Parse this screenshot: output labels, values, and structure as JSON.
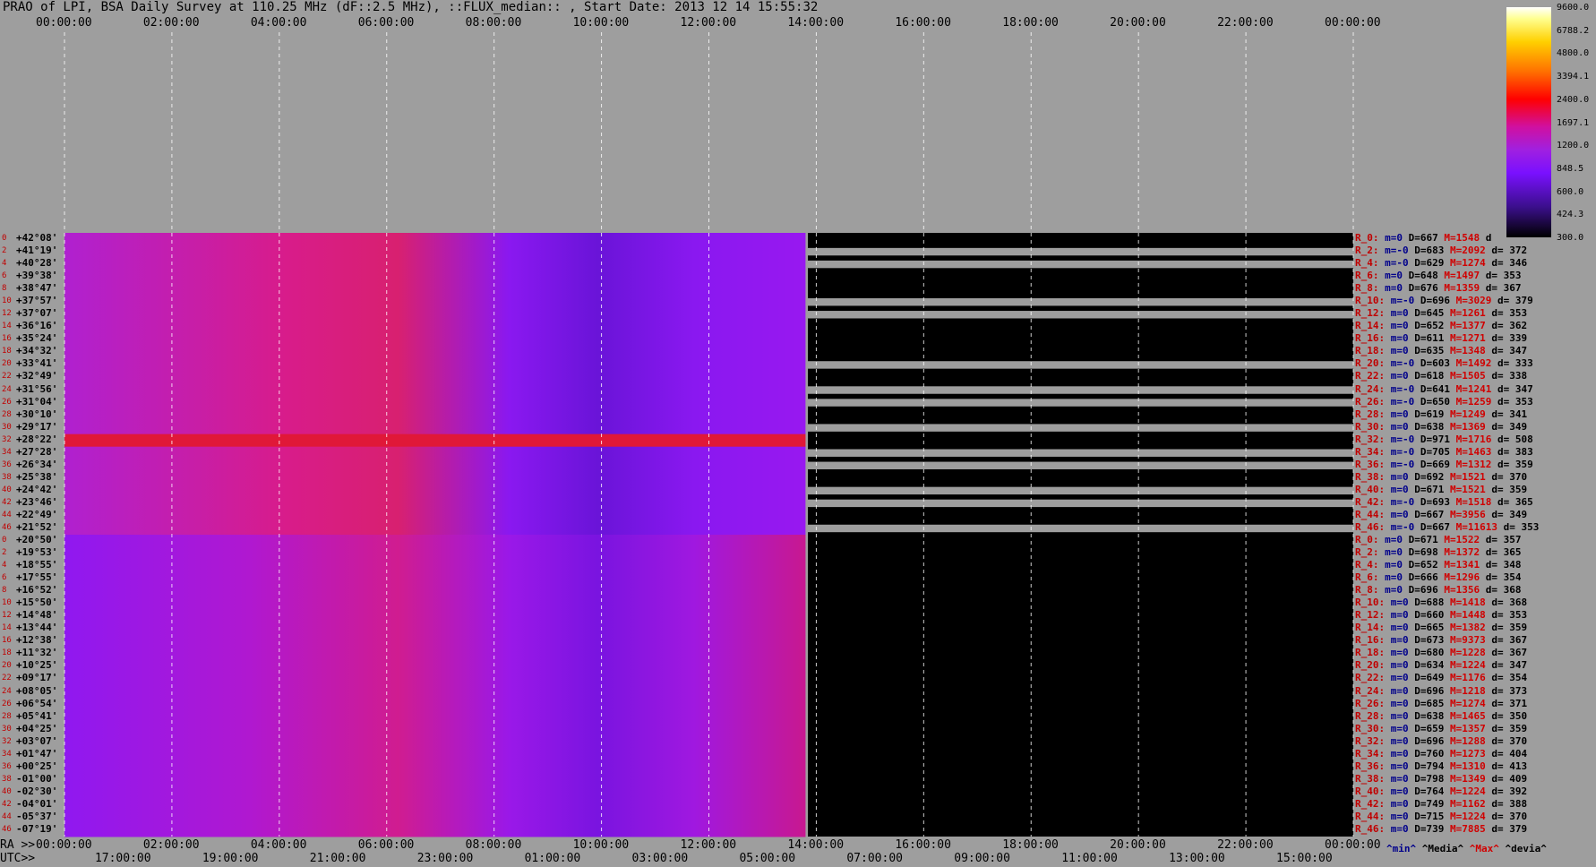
{
  "title": "PRAO of LPI, BSA Daily Survey at 110.25 MHz (dF::2.5 MHz), ::FLUX_median:: , Start Date: 2013 12 14 15:55:32",
  "chart_data": {
    "type": "heatmap",
    "title": "PRAO of LPI, BSA Daily Survey at 110.25 MHz (dF::2.5 MHz), ::FLUX_median:: , Start Date: 2013 12 14 15:55:32",
    "x_top_ticks": [
      "00:00:00",
      "02:00:00",
      "04:00:00",
      "06:00:00",
      "08:00:00",
      "10:00:00",
      "12:00:00",
      "14:00:00",
      "16:00:00",
      "18:00:00",
      "20:00:00",
      "22:00:00",
      "00:00:00"
    ],
    "x_bottom_prefix_ra": "RA >>",
    "x_bottom_prefix_utc": "UTC>>",
    "x_bottom_ra_ticks": [
      "00:00:00",
      "02:00:00",
      "04:00:00",
      "06:00:00",
      "08:00:00",
      "10:00:00",
      "12:00:00",
      "14:00:00",
      "16:00:00",
      "18:00:00",
      "20:00:00",
      "22:00:00",
      "00:00:00"
    ],
    "x_bottom_utc_ticks": [
      "17:00:00",
      "19:00:00",
      "21:00:00",
      "23:00:00",
      "01:00:00",
      "03:00:00",
      "05:00:00",
      "07:00:00",
      "09:00:00",
      "11:00:00",
      "13:00:00",
      "15:00:00"
    ],
    "colorbar_ticks": [
      "9600.0",
      "6788.2",
      "4800.0",
      "3394.1",
      "2400.0",
      "1697.1",
      "1200.0",
      "848.5",
      "600.0",
      "424.3",
      "300.0"
    ],
    "colorbar_colors": [
      "#000000",
      "#3a0f8a",
      "#7a10ff",
      "#a020e0",
      "#d010a0",
      "#ff0000",
      "#ff7000",
      "#ffd000",
      "#ffffff"
    ],
    "data_extent": {
      "x_fraction_recorded": 0.575
    },
    "rows": [
      {
        "idx": "0",
        "dec": "+42°08'",
        "lab": "R_0:",
        "m": "m=0",
        "D": "D=667",
        "M": "M=1548",
        "d": "d"
      },
      {
        "idx": "2",
        "dec": "+41°19'",
        "lab": "R_2:",
        "m": "m=-0",
        "D": "D=683",
        "M": "M=2092",
        "d": "d= 372"
      },
      {
        "idx": "4",
        "dec": "+40°28'",
        "lab": "R_4:",
        "m": "m=-0",
        "D": "D=629",
        "M": "M=1274",
        "d": "d= 346"
      },
      {
        "idx": "6",
        "dec": "+39°38'",
        "lab": "R_6:",
        "m": "m=0",
        "D": "D=648",
        "M": "M=1497",
        "d": "d= 353"
      },
      {
        "idx": "8",
        "dec": "+38°47'",
        "lab": "R_8:",
        "m": "m=0",
        "D": "D=676",
        "M": "M=1359",
        "d": "d= 367"
      },
      {
        "idx": "10",
        "dec": "+37°57'",
        "lab": "R_10:",
        "m": "m=-0",
        "D": "D=696",
        "M": "M=3029",
        "d": "d= 379"
      },
      {
        "idx": "12",
        "dec": "+37°07'",
        "lab": "R_12:",
        "m": "m=0",
        "D": "D=645",
        "M": "M=1261",
        "d": "d= 353"
      },
      {
        "idx": "14",
        "dec": "+36°16'",
        "lab": "R_14:",
        "m": "m=0",
        "D": "D=652",
        "M": "M=1377",
        "d": "d= 362"
      },
      {
        "idx": "16",
        "dec": "+35°24'",
        "lab": "R_16:",
        "m": "m=0",
        "D": "D=611",
        "M": "M=1271",
        "d": "d= 339"
      },
      {
        "idx": "18",
        "dec": "+34°32'",
        "lab": "R_18:",
        "m": "m=0",
        "D": "D=635",
        "M": "M=1348",
        "d": "d= 347"
      },
      {
        "idx": "20",
        "dec": "+33°41'",
        "lab": "R_20:",
        "m": "m=-0",
        "D": "D=603",
        "M": "M=1492",
        "d": "d= 333"
      },
      {
        "idx": "22",
        "dec": "+32°49'",
        "lab": "R_22:",
        "m": "m=0",
        "D": "D=618",
        "M": "M=1505",
        "d": "d= 338"
      },
      {
        "idx": "24",
        "dec": "+31°56'",
        "lab": "R_24:",
        "m": "m=-0",
        "D": "D=641",
        "M": "M=1241",
        "d": "d= 347"
      },
      {
        "idx": "26",
        "dec": "+31°04'",
        "lab": "R_26:",
        "m": "m=-0",
        "D": "D=650",
        "M": "M=1259",
        "d": "d= 353"
      },
      {
        "idx": "28",
        "dec": "+30°10'",
        "lab": "R_28:",
        "m": "m=0",
        "D": "D=619",
        "M": "M=1249",
        "d": "d= 341"
      },
      {
        "idx": "30",
        "dec": "+29°17'",
        "lab": "R_30:",
        "m": "m=0",
        "D": "D=638",
        "M": "M=1369",
        "d": "d= 349"
      },
      {
        "idx": "32",
        "dec": "+28°22'",
        "lab": "R_32:",
        "m": "m=-0",
        "D": "D=971",
        "M": "M=1716",
        "d": "d= 508"
      },
      {
        "idx": "34",
        "dec": "+27°28'",
        "lab": "R_34:",
        "m": "m=-0",
        "D": "D=705",
        "M": "M=1463",
        "d": "d= 383"
      },
      {
        "idx": "36",
        "dec": "+26°34'",
        "lab": "R_36:",
        "m": "m=-0",
        "D": "D=669",
        "M": "M=1312",
        "d": "d= 359"
      },
      {
        "idx": "38",
        "dec": "+25°38'",
        "lab": "R_38:",
        "m": "m=0",
        "D": "D=692",
        "M": "M=1521",
        "d": "d= 370"
      },
      {
        "idx": "40",
        "dec": "+24°42'",
        "lab": "R_40:",
        "m": "m=0",
        "D": "D=671",
        "M": "M=1521",
        "d": "d= 359"
      },
      {
        "idx": "42",
        "dec": "+23°46'",
        "lab": "R_42:",
        "m": "m=-0",
        "D": "D=693",
        "M": "M=1518",
        "d": "d= 365"
      },
      {
        "idx": "44",
        "dec": "+22°49'",
        "lab": "R_44:",
        "m": "m=0",
        "D": "D=667",
        "M": "M=3956",
        "d": "d= 349"
      },
      {
        "idx": "46",
        "dec": "+21°52'",
        "lab": "R_46:",
        "m": "m=-0",
        "D": "D=667",
        "M": "M=11613",
        "d": "d= 353"
      },
      {
        "idx": "0",
        "dec": "+20°50'",
        "lab": "R_0:",
        "m": "m=0",
        "D": "D=671",
        "M": "M=1522",
        "d": "d= 357"
      },
      {
        "idx": "2",
        "dec": "+19°53'",
        "lab": "R_2:",
        "m": "m=0",
        "D": "D=698",
        "M": "M=1372",
        "d": "d= 365"
      },
      {
        "idx": "4",
        "dec": "+18°55'",
        "lab": "R_4:",
        "m": "m=0",
        "D": "D=652",
        "M": "M=1341",
        "d": "d= 348"
      },
      {
        "idx": "6",
        "dec": "+17°55'",
        "lab": "R_6:",
        "m": "m=0",
        "D": "D=666",
        "M": "M=1296",
        "d": "d= 354"
      },
      {
        "idx": "8",
        "dec": "+16°52'",
        "lab": "R_8:",
        "m": "m=0",
        "D": "D=696",
        "M": "M=1356",
        "d": "d= 368"
      },
      {
        "idx": "10",
        "dec": "+15°50'",
        "lab": "R_10:",
        "m": "m=0",
        "D": "D=688",
        "M": "M=1418",
        "d": "d= 368"
      },
      {
        "idx": "12",
        "dec": "+14°48'",
        "lab": "R_12:",
        "m": "m=0",
        "D": "D=660",
        "M": "M=1448",
        "d": "d= 353"
      },
      {
        "idx": "14",
        "dec": "+13°44'",
        "lab": "R_14:",
        "m": "m=0",
        "D": "D=665",
        "M": "M=1382",
        "d": "d= 359"
      },
      {
        "idx": "16",
        "dec": "+12°38'",
        "lab": "R_16:",
        "m": "m=0",
        "D": "D=673",
        "M": "M=9373",
        "d": "d= 367"
      },
      {
        "idx": "18",
        "dec": "+11°32'",
        "lab": "R_18:",
        "m": "m=0",
        "D": "D=680",
        "M": "M=1228",
        "d": "d= 367"
      },
      {
        "idx": "20",
        "dec": "+10°25'",
        "lab": "R_20:",
        "m": "m=0",
        "D": "D=634",
        "M": "M=1224",
        "d": "d= 347"
      },
      {
        "idx": "22",
        "dec": "+09°17'",
        "lab": "R_22:",
        "m": "m=0",
        "D": "D=649",
        "M": "M=1176",
        "d": "d= 354"
      },
      {
        "idx": "24",
        "dec": "+08°05'",
        "lab": "R_24:",
        "m": "m=0",
        "D": "D=696",
        "M": "M=1218",
        "d": "d= 373"
      },
      {
        "idx": "26",
        "dec": "+06°54'",
        "lab": "R_26:",
        "m": "m=0",
        "D": "D=685",
        "M": "M=1274",
        "d": "d= 371"
      },
      {
        "idx": "28",
        "dec": "+05°41'",
        "lab": "R_28:",
        "m": "m=0",
        "D": "D=638",
        "M": "M=1465",
        "d": "d= 350"
      },
      {
        "idx": "30",
        "dec": "+04°25'",
        "lab": "R_30:",
        "m": "m=0",
        "D": "D=659",
        "M": "M=1357",
        "d": "d= 359"
      },
      {
        "idx": "32",
        "dec": "+03°07'",
        "lab": "R_32:",
        "m": "m=0",
        "D": "D=696",
        "M": "M=1288",
        "d": "d= 370"
      },
      {
        "idx": "34",
        "dec": "+01°47'",
        "lab": "R_34:",
        "m": "m=0",
        "D": "D=760",
        "M": "M=1273",
        "d": "d= 404"
      },
      {
        "idx": "36",
        "dec": "+00°25'",
        "lab": "R_36:",
        "m": "m=0",
        "D": "D=794",
        "M": "M=1310",
        "d": "d= 413"
      },
      {
        "idx": "38",
        "dec": "-01°00'",
        "lab": "R_38:",
        "m": "m=0",
        "D": "D=798",
        "M": "M=1349",
        "d": "d= 409"
      },
      {
        "idx": "40",
        "dec": "-02°30'",
        "lab": "R_40:",
        "m": "m=0",
        "D": "D=764",
        "M": "M=1224",
        "d": "d= 392"
      },
      {
        "idx": "42",
        "dec": "-04°01'",
        "lab": "R_42:",
        "m": "m=0",
        "D": "D=749",
        "M": "M=1162",
        "d": "d= 388"
      },
      {
        "idx": "44",
        "dec": "-05°37'",
        "lab": "R_44:",
        "m": "m=0",
        "D": "D=715",
        "M": "M=1224",
        "d": "d= 370"
      },
      {
        "idx": "46",
        "dec": "-07°19'",
        "lab": "R_46:",
        "m": "m=0",
        "D": "D=739",
        "M": "M=7885",
        "d": "d= 379"
      }
    ],
    "legend_footer": {
      "min": "^min^",
      "median": "^Media^",
      "max": "^Max^",
      "dev": "^devia^"
    }
  }
}
